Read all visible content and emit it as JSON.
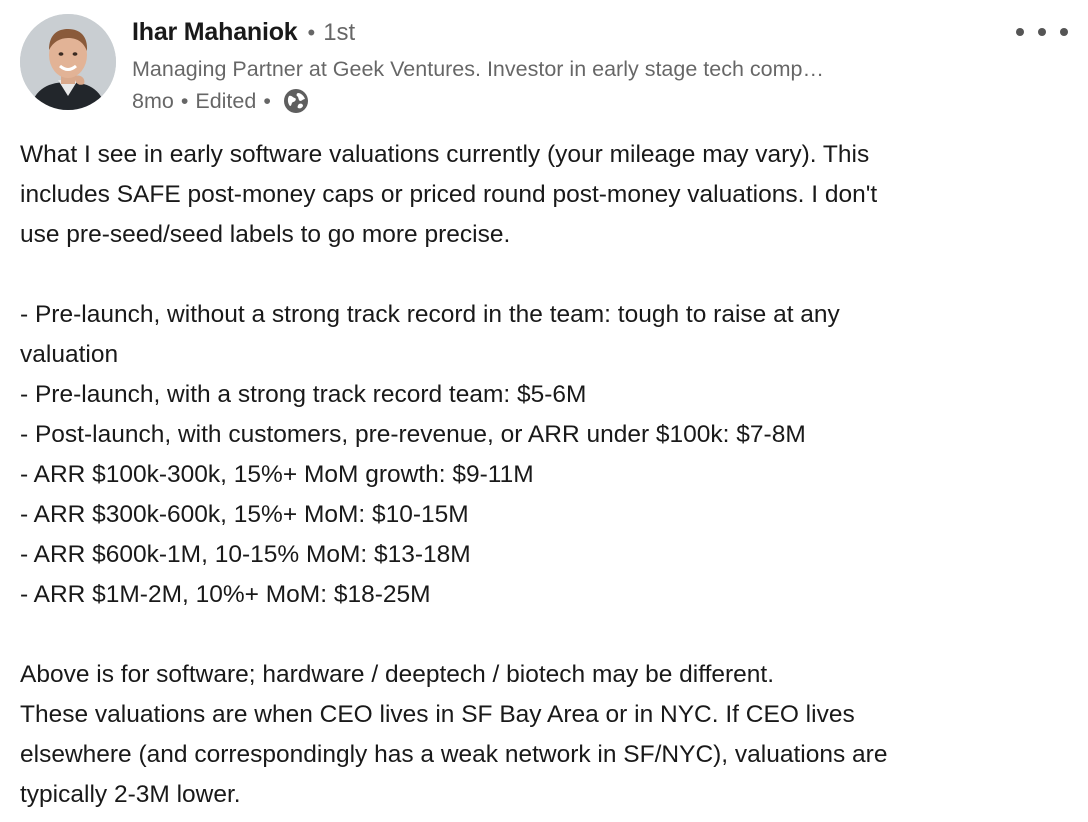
{
  "author": {
    "name": "Ihar Mahaniok",
    "degree": "1st",
    "headline": "Managing Partner at Geek Ventures. Investor in early stage tech comp…",
    "age": "8mo",
    "edited": "Edited",
    "visibility_icon": "globe-icon"
  },
  "menu": {
    "icon": "more-horizontal-icon"
  },
  "post": {
    "intro": [
      "What I see in early software valuations currently (your mileage may vary). This",
      "includes SAFE post-money caps or priced round post-money valuations. I don't",
      "use pre-seed/seed labels to go more precise."
    ],
    "list": [
      "- Pre-launch, without a strong track record in the team: tough to raise at any",
      "valuation",
      "- Pre-launch, with a strong track record team: $5-6M",
      "- Post-launch, with customers, pre-revenue, or ARR under $100k: $7-8M",
      "- ARR $100k-300k, 15%+ MoM growth: $9-11M",
      "- ARR $300k-600k, 15%+ MoM: $10-15M",
      "- ARR $600k-1M, 10-15% MoM: $13-18M",
      "- ARR $1M-2M, 10%+ MoM: $18-25M"
    ],
    "outro": [
      "Above is for software; hardware / deeptech / biotech may be different.",
      "These valuations are when CEO lives in SF Bay Area or in NYC. If CEO lives",
      "elsewhere (and correspondingly has a weak network in SF/NYC), valuations are",
      "typically 2-3M lower."
    ]
  },
  "colors": {
    "text_primary": "#1a1a1a",
    "text_secondary": "#666666",
    "background": "#ffffff"
  }
}
